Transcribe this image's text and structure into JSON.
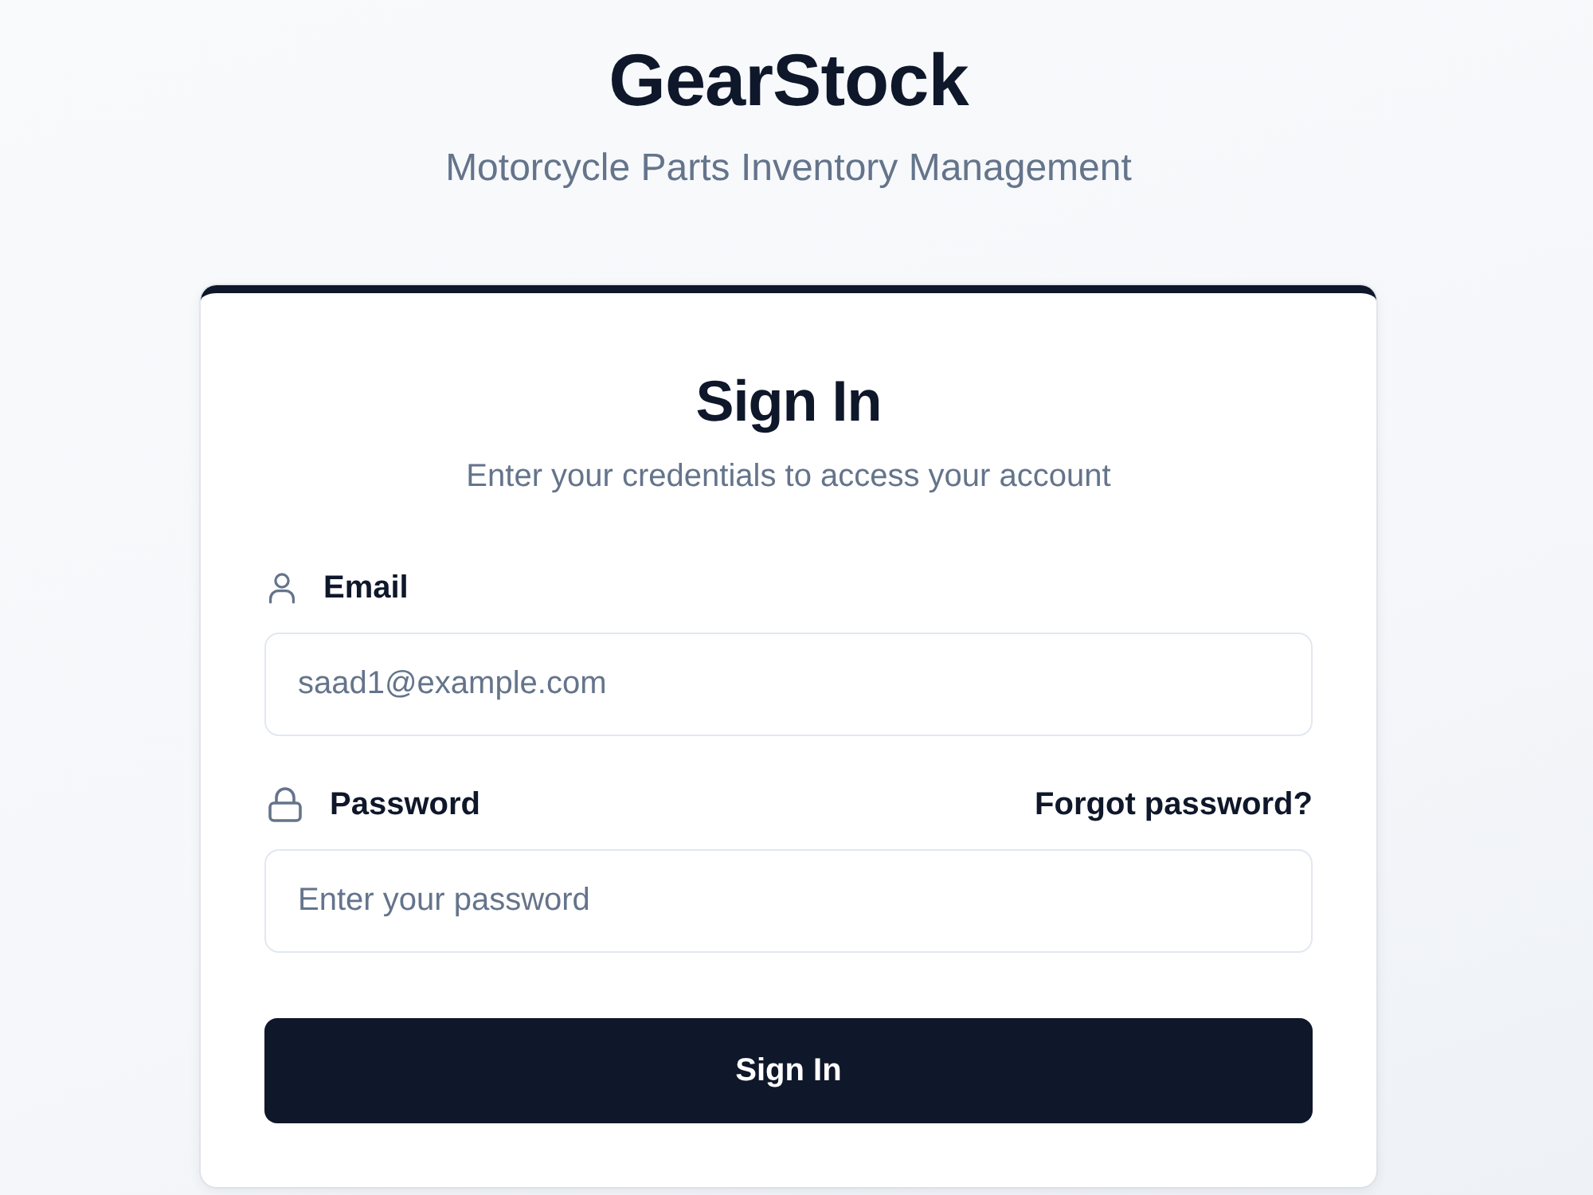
{
  "header": {
    "title": "GearStock",
    "subtitle": "Motorcycle Parts Inventory Management"
  },
  "card": {
    "title": "Sign In",
    "subtitle": "Enter your credentials to access your account",
    "fields": [
      {
        "kind": "email",
        "label": "Email",
        "placeholder": "saad1@example.com"
      },
      {
        "kind": "password",
        "label": "Password",
        "placeholder": "Enter your password",
        "link": "Forgot password?"
      }
    ],
    "button": "Sign In"
  }
}
